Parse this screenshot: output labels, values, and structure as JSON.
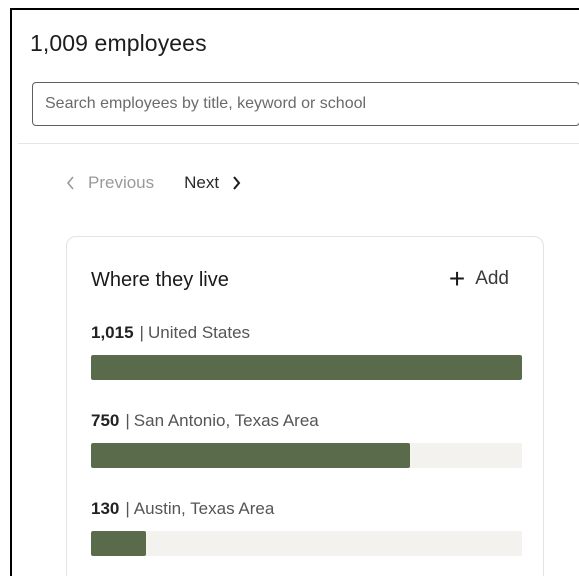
{
  "header": {
    "title": "1,009 employees"
  },
  "search": {
    "placeholder": "Search employees by title, keyword or school"
  },
  "pager": {
    "previous_label": "Previous",
    "next_label": "Next",
    "previous_enabled": false
  },
  "card": {
    "title": "Where they live",
    "add_label": "Add"
  },
  "locations": [
    {
      "count": "1,015",
      "name": "United States",
      "fraction": 1.0
    },
    {
      "count": "750",
      "name": "San Antonio, Texas Area",
      "fraction": 0.739
    },
    {
      "count": "130",
      "name": "Austin, Texas Area",
      "fraction": 0.128
    }
  ],
  "colors": {
    "bar_fill": "#5a6b4c",
    "bar_track": "#f3f2ee"
  },
  "icons": {
    "previous": "chevron-left-icon",
    "next": "chevron-right-icon",
    "add": "plus-icon"
  }
}
